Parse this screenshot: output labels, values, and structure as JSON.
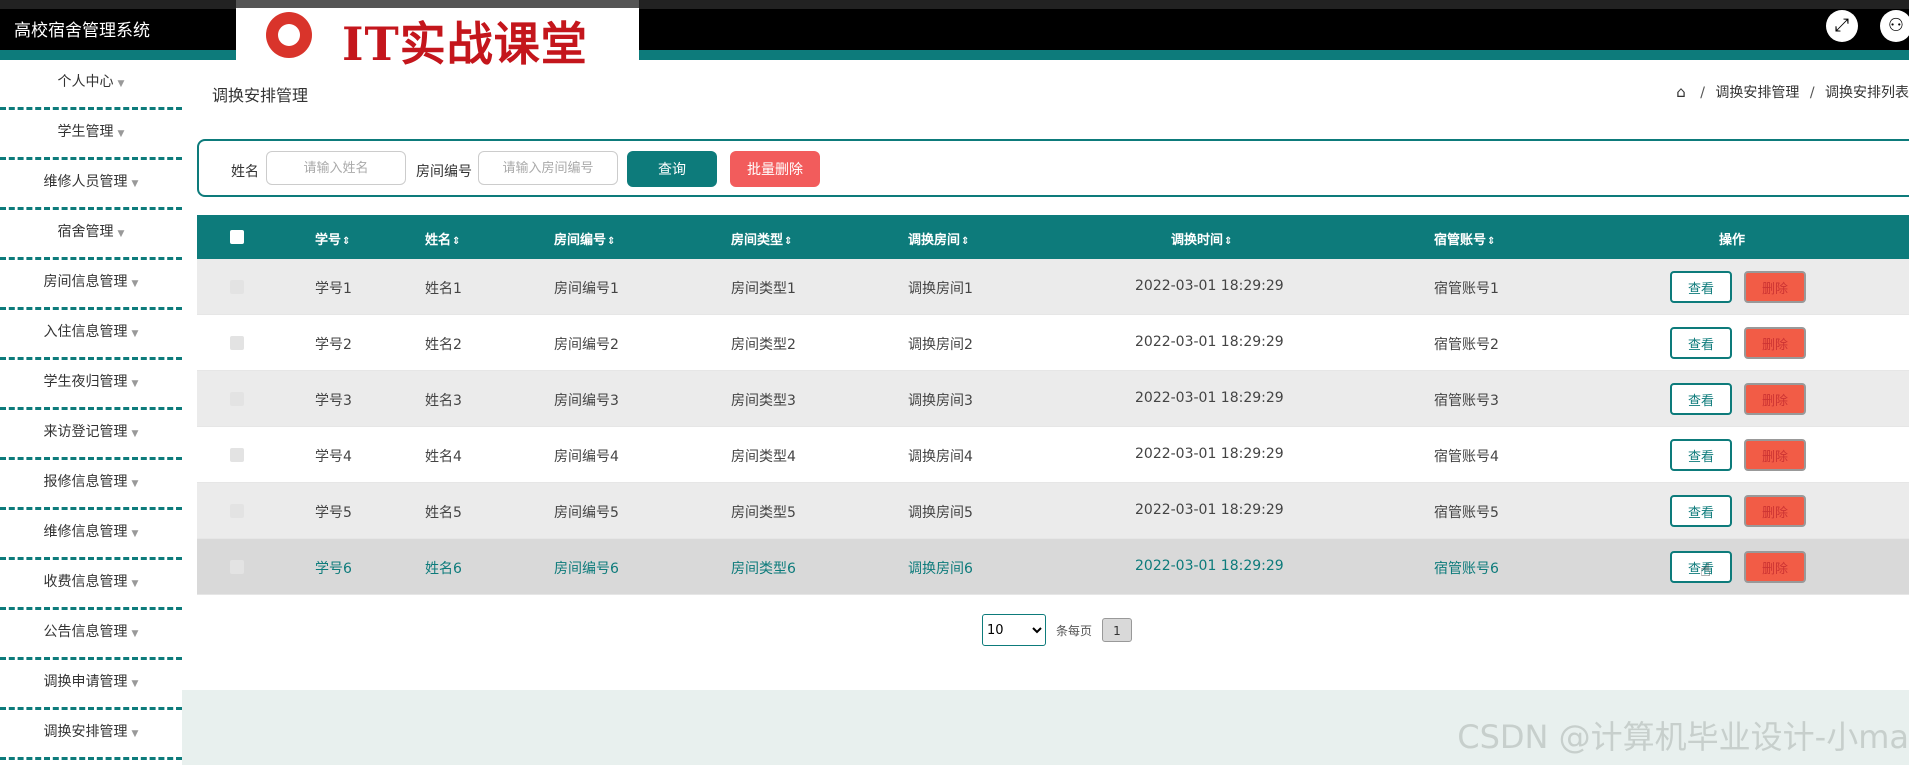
{
  "header": {
    "app_title": "高校宿舍管理系统",
    "logo_text": "IT实战课堂",
    "icons": [
      "fullscreen-icon",
      "user-icon"
    ]
  },
  "sidebar": {
    "items": [
      {
        "label": "个人中心"
      },
      {
        "label": "学生管理"
      },
      {
        "label": "维修人员管理"
      },
      {
        "label": "宿舍管理"
      },
      {
        "label": "房间信息管理"
      },
      {
        "label": "入住信息管理"
      },
      {
        "label": "学生夜归管理"
      },
      {
        "label": "来访登记管理"
      },
      {
        "label": "报修信息管理"
      },
      {
        "label": "维修信息管理"
      },
      {
        "label": "收费信息管理"
      },
      {
        "label": "公告信息管理"
      },
      {
        "label": "调换申请管理"
      },
      {
        "label": "调换安排管理"
      }
    ]
  },
  "page": {
    "title": "调换安排管理",
    "breadcrumb": [
      "调换安排管理",
      "调换安排列表"
    ]
  },
  "search": {
    "name_label": "姓名",
    "name_placeholder": "请输入姓名",
    "room_label": "房间编号",
    "room_placeholder": "请输入房间编号",
    "query_button": "查询",
    "batch_delete_button": "批量删除"
  },
  "table": {
    "columns": [
      "学号",
      "姓名",
      "房间编号",
      "房间类型",
      "调换房间",
      "调换时间",
      "宿管账号",
      "操作"
    ],
    "sort_indicator": "⇕",
    "view_label": "查看",
    "delete_label": "删除",
    "rows": [
      {
        "student_no": "学号1",
        "name": "姓名1",
        "room_no": "房间编号1",
        "room_type": "房间类型1",
        "swap_room": "调换房间1",
        "swap_time": "2022-03-01 18:29:29",
        "manager": "宿管账号1"
      },
      {
        "student_no": "学号2",
        "name": "姓名2",
        "room_no": "房间编号2",
        "room_type": "房间类型2",
        "swap_room": "调换房间2",
        "swap_time": "2022-03-01 18:29:29",
        "manager": "宿管账号2"
      },
      {
        "student_no": "学号3",
        "name": "姓名3",
        "room_no": "房间编号3",
        "room_type": "房间类型3",
        "swap_room": "调换房间3",
        "swap_time": "2022-03-01 18:29:29",
        "manager": "宿管账号3"
      },
      {
        "student_no": "学号4",
        "name": "姓名4",
        "room_no": "房间编号4",
        "room_type": "房间类型4",
        "swap_room": "调换房间4",
        "swap_time": "2022-03-01 18:29:29",
        "manager": "宿管账号4"
      },
      {
        "student_no": "学号5",
        "name": "姓名5",
        "room_no": "房间编号5",
        "room_type": "房间类型5",
        "swap_room": "调换房间5",
        "swap_time": "2022-03-01 18:29:29",
        "manager": "宿管账号5"
      },
      {
        "student_no": "学号6",
        "name": "姓名6",
        "room_no": "房间编号6",
        "room_type": "房间类型6",
        "swap_room": "调换房间6",
        "swap_time": "2022-03-01 18:29:29",
        "manager": "宿管账号6"
      }
    ]
  },
  "pagination": {
    "page_size": "10",
    "page_size_options": [
      "10"
    ],
    "per_page_label": "条每页",
    "current_page": "1"
  },
  "watermark": "CSDN @计算机毕业设计-小ma",
  "colors": {
    "primary": "#0d7b7b",
    "danger": "#f25c46",
    "topbar": "#000000"
  }
}
